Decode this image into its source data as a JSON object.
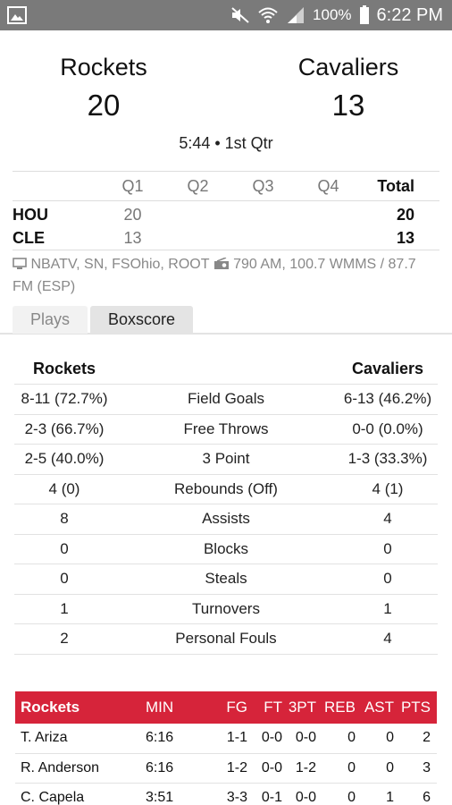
{
  "status_bar": {
    "battery": "100%",
    "time": "6:22 PM",
    "icons": [
      "gallery-icon",
      "mute-icon",
      "wifi-icon",
      "signal-icon",
      "battery-icon"
    ]
  },
  "game": {
    "home_team": "Rockets",
    "home_score": "20",
    "away_team": "Cavaliers",
    "away_score": "13",
    "clock": "5:44 • 1st Qtr"
  },
  "linescore": {
    "headers": [
      "Q1",
      "Q2",
      "Q3",
      "Q4",
      "Total"
    ],
    "rows": [
      {
        "team": "HOU",
        "q1": "20",
        "q2": "",
        "q3": "",
        "q4": "",
        "total": "20"
      },
      {
        "team": "CLE",
        "q1": "13",
        "q2": "",
        "q3": "",
        "q4": "",
        "total": "13"
      }
    ]
  },
  "broadcast": {
    "tv": "NBATV, SN, FSOhio, ROOT",
    "radio": "790 AM, 100.7 WMMS / 87.7 FM (ESP)"
  },
  "tabs": [
    {
      "label": "Plays",
      "active": false
    },
    {
      "label": "Boxscore",
      "active": true
    }
  ],
  "team_stats": {
    "left_team": "Rockets",
    "right_team": "Cavaliers",
    "rows": [
      {
        "left": "8-11 (72.7%)",
        "label": "Field Goals",
        "right": "6-13 (46.2%)"
      },
      {
        "left": "2-3 (66.7%)",
        "label": "Free Throws",
        "right": "0-0 (0.0%)"
      },
      {
        "left": "2-5 (40.0%)",
        "label": "3 Point",
        "right": "1-3 (33.3%)"
      },
      {
        "left": "4 (0)",
        "label": "Rebounds (Off)",
        "right": "4 (1)"
      },
      {
        "left": "8",
        "label": "Assists",
        "right": "4"
      },
      {
        "left": "0",
        "label": "Blocks",
        "right": "0"
      },
      {
        "left": "0",
        "label": "Steals",
        "right": "0"
      },
      {
        "left": "1",
        "label": "Turnovers",
        "right": "1"
      },
      {
        "left": "2",
        "label": "Personal Fouls",
        "right": "4"
      }
    ]
  },
  "player_box": {
    "team": "Rockets",
    "header_color": "#d6243a",
    "columns": [
      "MIN",
      "FG",
      "FT",
      "3PT",
      "REB",
      "AST",
      "PTS"
    ],
    "players": [
      {
        "name": "T. Ariza",
        "min": "6:16",
        "fg": "1-1",
        "ft": "0-0",
        "tpt": "0-0",
        "reb": "0",
        "ast": "0",
        "pts": "2"
      },
      {
        "name": "R. Anderson",
        "min": "6:16",
        "fg": "1-2",
        "ft": "0-0",
        "tpt": "1-2",
        "reb": "0",
        "ast": "0",
        "pts": "3"
      },
      {
        "name": "C. Capela",
        "min": "3:51",
        "fg": "3-3",
        "ft": "0-1",
        "tpt": "0-0",
        "reb": "0",
        "ast": "1",
        "pts": "6"
      }
    ]
  }
}
